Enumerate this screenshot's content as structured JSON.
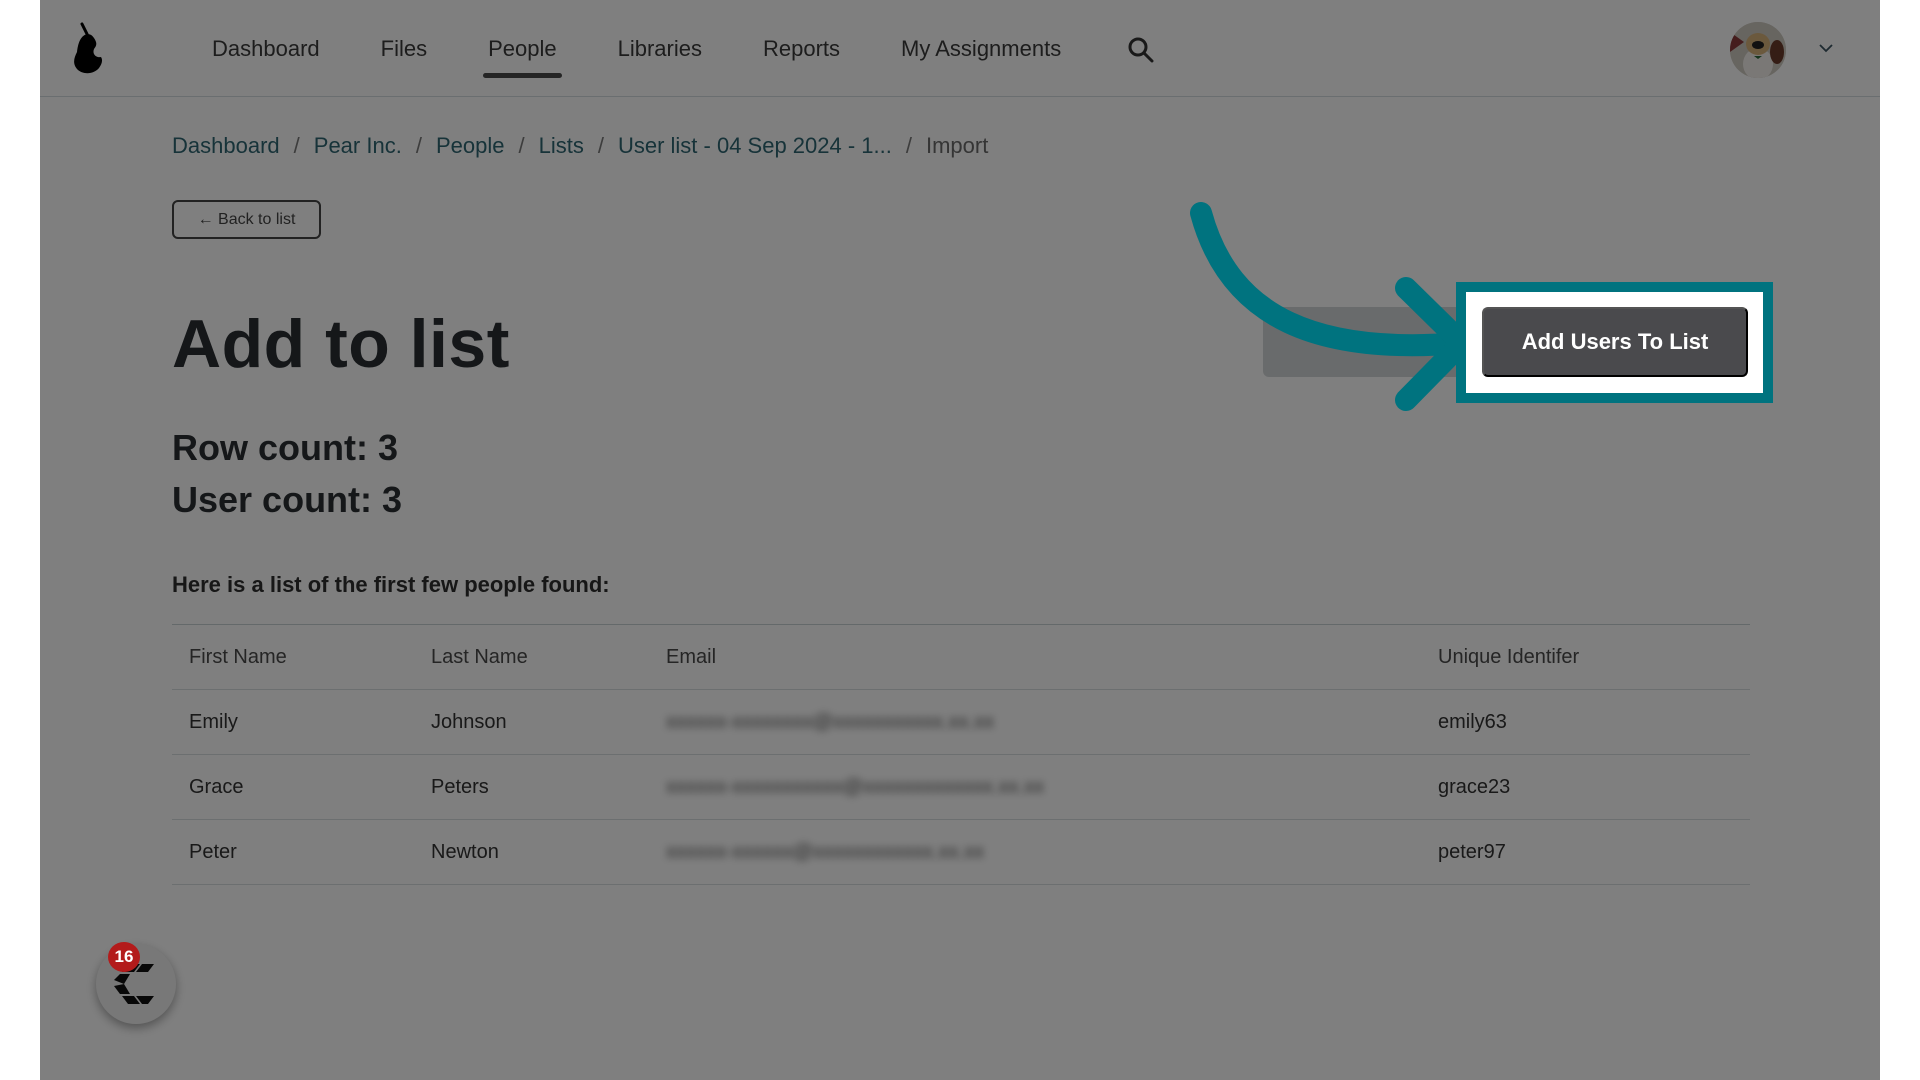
{
  "header": {
    "logo": "pear-logo",
    "nav": [
      {
        "label": "Dashboard",
        "active": false
      },
      {
        "label": "Files",
        "active": false
      },
      {
        "label": "People",
        "active": true
      },
      {
        "label": "Libraries",
        "active": false
      },
      {
        "label": "Reports",
        "active": false
      },
      {
        "label": "My Assignments",
        "active": false
      }
    ],
    "search_icon": "search-icon",
    "avatar_alt": "User avatar (dog photo)",
    "menu_icon": "chevron-down-icon"
  },
  "breadcrumb": [
    {
      "label": "Dashboard"
    },
    {
      "label": "Pear Inc."
    },
    {
      "label": "People"
    },
    {
      "label": "Lists"
    },
    {
      "label": "User list - 04 Sep 2024 - 1..."
    },
    {
      "label": "Import",
      "current": true
    }
  ],
  "back_button": "← Back to list",
  "page_title": "Add to list",
  "row_count": "Row count: 3",
  "user_count": "User count: 3",
  "intro": "Here is a list of the first few people found:",
  "table": {
    "columns": [
      "First Name",
      "Last Name",
      "Email",
      "Unique Identifer"
    ],
    "rows": [
      {
        "first": "Emily",
        "last": "Johnson",
        "email": "[redacted]",
        "uid": "emily63"
      },
      {
        "first": "Grace",
        "last": "Peters",
        "email": "[redacted]",
        "uid": "grace23"
      },
      {
        "first": "Peter",
        "last": "Newton",
        "email": "[redacted]",
        "uid": "peter97"
      }
    ]
  },
  "primary_action": "Add Users To List",
  "annotation": {
    "type": "arrow",
    "color": "#00737f",
    "highlight_color": "#00737f"
  },
  "widget": {
    "icon": "chat-widget-icon",
    "badge_count": "16"
  }
}
